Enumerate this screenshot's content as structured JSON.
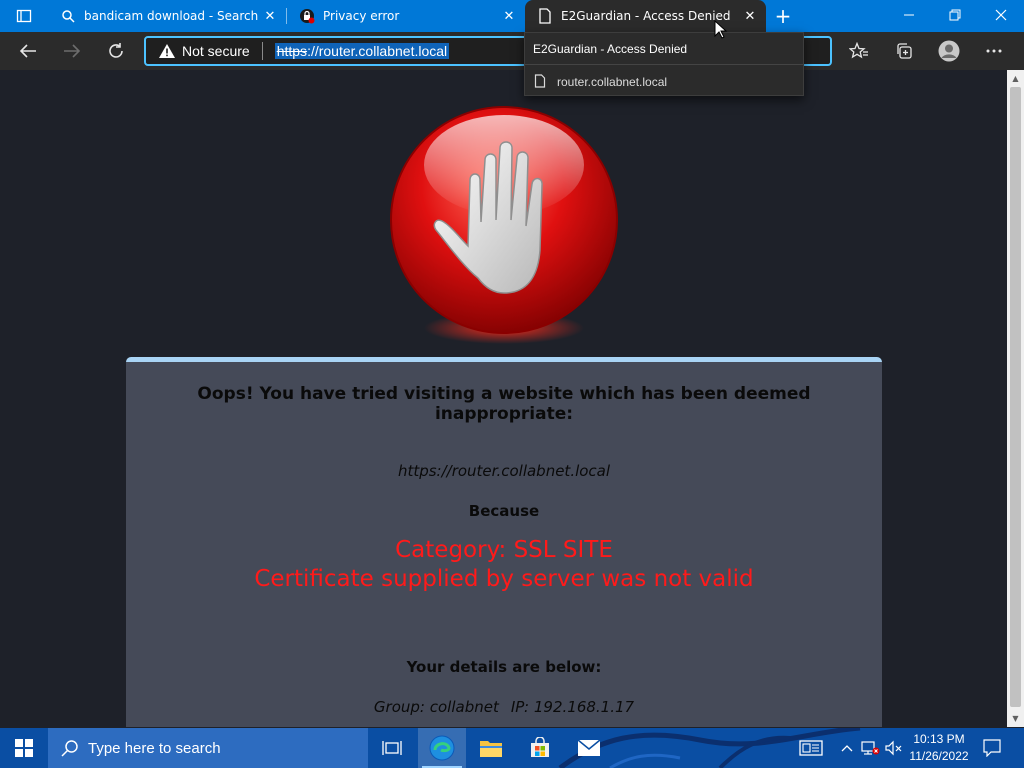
{
  "tabs": [
    {
      "title": "bandicam download - Search",
      "icon": "search-icon"
    },
    {
      "title": "Privacy error",
      "icon": "privacy-error-icon"
    },
    {
      "title": "E2Guardian - Access Denied",
      "icon": "page-icon",
      "active": true
    }
  ],
  "address_bar": {
    "security_label": "Not secure",
    "url_scheme": "https",
    "url_rest": "://router.collabnet.local"
  },
  "tooltip": {
    "title": "E2Guardian - Access Denied",
    "url": "router.collabnet.local"
  },
  "page": {
    "headline": "Oops! You have tried visiting a website which has been deemed inappropriate:",
    "blocked_url": "https://router.collabnet.local",
    "because": "Because",
    "reason_category": "Category: SSL SITE",
    "reason_detail": "Certificate supplied by server was not valid",
    "details_heading": "Your details are below:",
    "group_label": "Group: collabnet",
    "ip_label": "IP: 192.168.1.17"
  },
  "taskbar": {
    "search_placeholder": "Type here to search",
    "time": "10:13 PM",
    "date": "11/26/2022"
  },
  "colors": {
    "accent": "#0078d7",
    "reason_red": "#ff1a1a",
    "panel": "#454a58",
    "panel_border": "#a9d4f5"
  }
}
